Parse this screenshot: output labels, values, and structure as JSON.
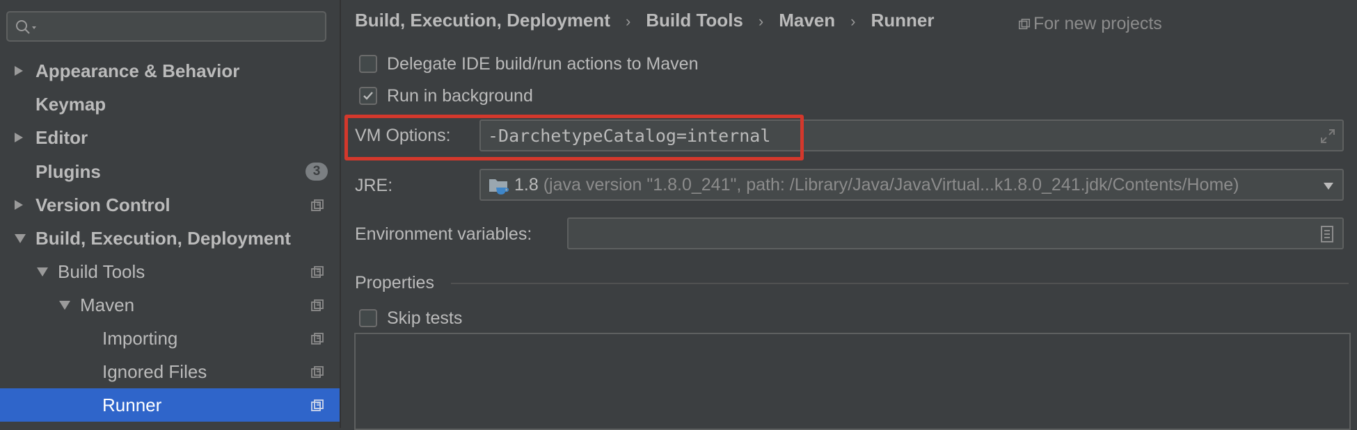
{
  "search": {
    "placeholder": ""
  },
  "sidebar": {
    "items": [
      {
        "label": "Appearance & Behavior"
      },
      {
        "label": "Keymap"
      },
      {
        "label": "Editor"
      },
      {
        "label": "Plugins",
        "badge": "3"
      },
      {
        "label": "Version Control"
      },
      {
        "label": "Build, Execution, Deployment"
      },
      {
        "label": "Build Tools"
      },
      {
        "label": "Maven"
      },
      {
        "label": "Importing"
      },
      {
        "label": "Ignored Files"
      },
      {
        "label": "Runner"
      }
    ]
  },
  "header": {
    "breadcrumb": [
      "Build, Execution, Deployment",
      "Build Tools",
      "Maven",
      "Runner"
    ],
    "separator": "›",
    "scope_label": "For new projects"
  },
  "options": {
    "delegate": {
      "label": "Delegate IDE build/run actions to Maven",
      "checked": false
    },
    "background": {
      "label": "Run in background",
      "checked": true
    },
    "vm_options": {
      "label": "VM Options:",
      "value": "-DarchetypeCatalog=internal"
    },
    "jre": {
      "label": "JRE:",
      "version": "1.8",
      "detail": "(java version \"1.8.0_241\", path: /Library/Java/JavaVirtual...k1.8.0_241.jdk/Contents/Home)"
    },
    "env": {
      "label": "Environment variables:",
      "value": ""
    }
  },
  "properties": {
    "title": "Properties",
    "skip_tests": {
      "label": "Skip tests",
      "checked": false
    }
  },
  "colors": {
    "selection": "#2f65ca",
    "highlight": "#d4382c",
    "background": "#3c3f41"
  }
}
